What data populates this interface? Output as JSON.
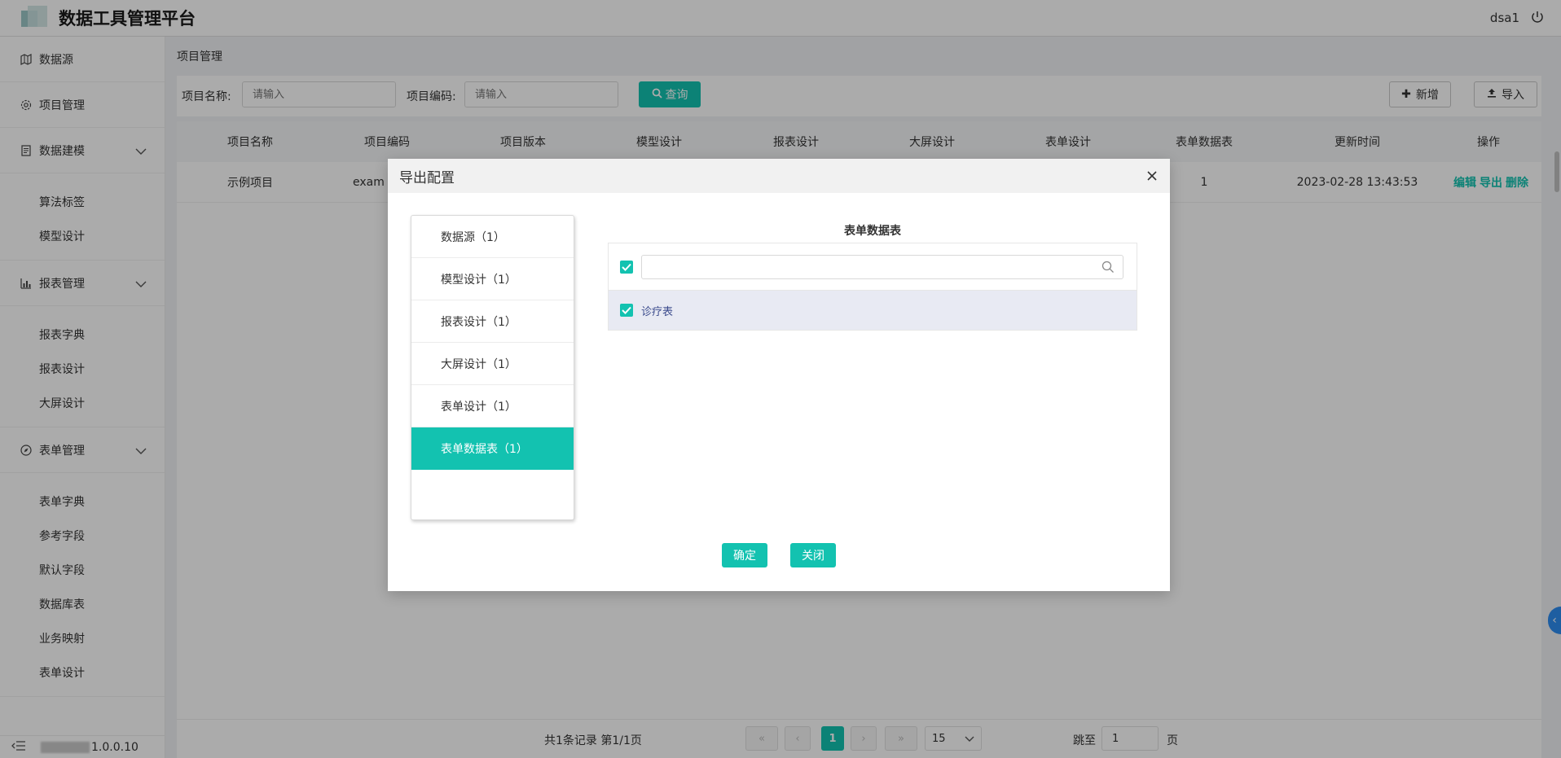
{
  "app": {
    "title": "数据工具管理平台",
    "user": "dsa1",
    "version": "1.0.0.10"
  },
  "sidebar": {
    "items": [
      {
        "label": "数据源",
        "icon": "map-icon"
      },
      {
        "label": "项目管理",
        "icon": "gear-icon"
      },
      {
        "label": "数据建模",
        "icon": "document-icon",
        "children": [
          "算法标签",
          "模型设计"
        ]
      },
      {
        "label": "报表管理",
        "icon": "bar-chart-icon",
        "children": [
          "报表字典",
          "报表设计",
          "大屏设计"
        ]
      },
      {
        "label": "表单管理",
        "icon": "compass-icon",
        "children": [
          "表单字典",
          "参考字段",
          "默认字段",
          "数据库表",
          "业务映射",
          "表单设计"
        ]
      }
    ]
  },
  "breadcrumb": "项目管理",
  "search": {
    "name_label": "项目名称:",
    "name_placeholder": "请输入",
    "code_label": "项目编码:",
    "code_placeholder": "请输入",
    "query_button": "查询",
    "add_button": "新增",
    "import_button": "导入"
  },
  "table": {
    "columns": [
      "项目名称",
      "项目编码",
      "项目版本",
      "模型设计",
      "报表设计",
      "大屏设计",
      "表单设计",
      "表单数据表",
      "更新时间",
      "操作"
    ],
    "rows": [
      {
        "name": "示例项目",
        "code": "exam",
        "form_data": "1",
        "updated": "2023-02-28 13:43:53",
        "ops": [
          "编辑",
          "导出",
          "删除"
        ]
      }
    ]
  },
  "pager": {
    "summary": "共1条记录 第1/1页",
    "current": "1",
    "page_size": "15",
    "jump_label": "跳至",
    "jump_value": "1",
    "page_unit": "页"
  },
  "modal": {
    "title": "导出配置",
    "categories": [
      {
        "label": "数据源（1）"
      },
      {
        "label": "模型设计（1）"
      },
      {
        "label": "报表设计（1）"
      },
      {
        "label": "大屏设计（1）"
      },
      {
        "label": "表单设计（1）"
      },
      {
        "label": "表单数据表（1）",
        "active": true
      }
    ],
    "panel_title": "表单数据表",
    "search_value": "",
    "items": [
      "诊疗表"
    ],
    "confirm": "确定",
    "close": "关闭"
  },
  "colors": {
    "accent": "#13c2b0",
    "overlay": "rgba(0,0,0,0.33)",
    "selected_row": "#e8eaf3"
  }
}
